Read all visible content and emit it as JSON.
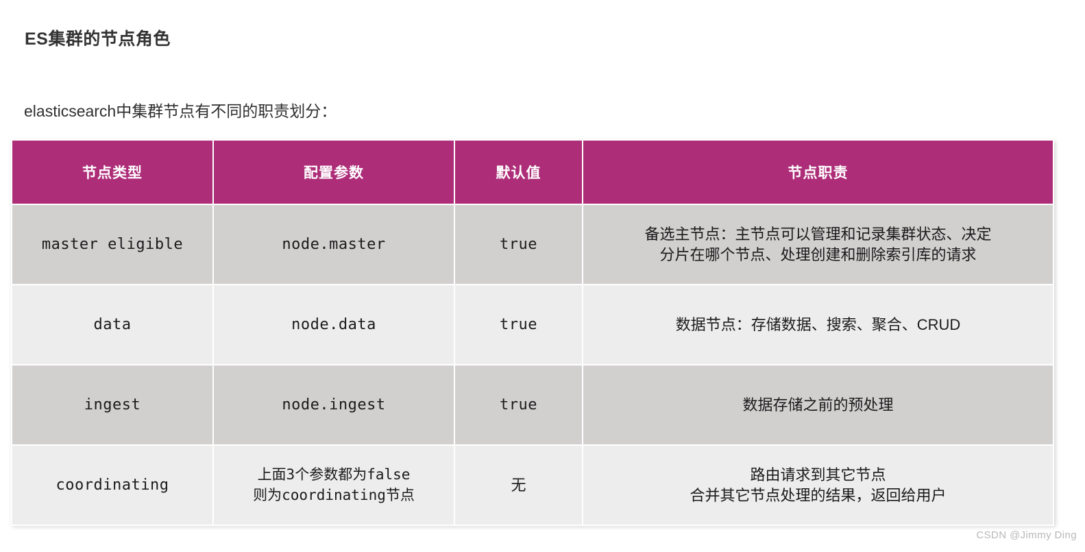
{
  "page": {
    "title": "ES集群的节点角色",
    "intro": "elasticsearch中集群节点有不同的职责划分："
  },
  "table": {
    "headers": [
      "节点类型",
      "配置参数",
      "默认值",
      "节点职责"
    ],
    "rows": [
      {
        "node_type": "master eligible",
        "config_param": "node.master",
        "default_value": "true",
        "responsibility_line1": "备选主节点：主节点可以管理和记录集群状态、决定",
        "responsibility_line2": "分片在哪个节点、处理创建和删除索引库的请求"
      },
      {
        "node_type": "data",
        "config_param": "node.data",
        "default_value": "true",
        "responsibility_line1": "数据节点：存储数据、搜索、聚合、CRUD",
        "responsibility_line2": ""
      },
      {
        "node_type": "ingest",
        "config_param": "node.ingest",
        "default_value": "true",
        "responsibility_line1": "数据存储之前的预处理",
        "responsibility_line2": ""
      },
      {
        "node_type": "coordinating",
        "config_param_line1": "上面3个参数都为false",
        "config_param_line2": "则为coordinating节点",
        "default_value": "无",
        "responsibility_line1": "路由请求到其它节点",
        "responsibility_line2": "合并其它节点处理的结果，返回给用户"
      }
    ]
  },
  "watermark": "CSDN @Jimmy Ding",
  "colors": {
    "header_bg": "#AD2D78",
    "row_shade": "#D2CFCF",
    "row_light": "#EDEDED",
    "title_color": "#333333"
  }
}
